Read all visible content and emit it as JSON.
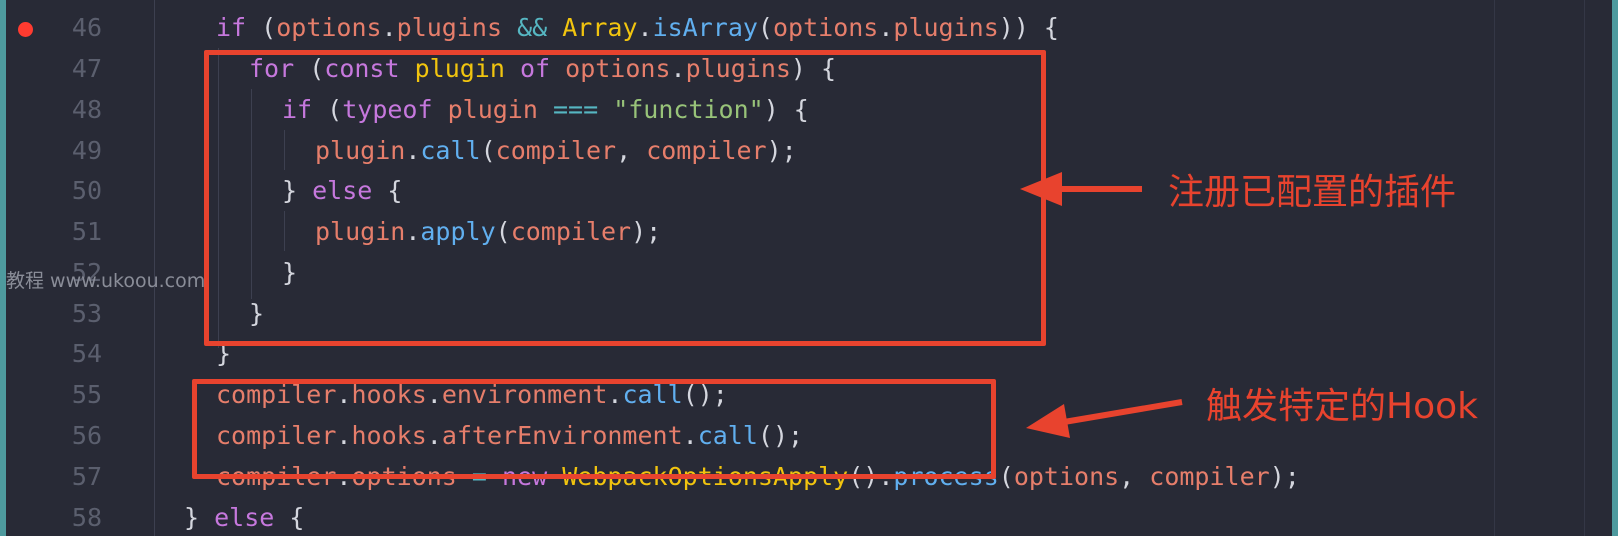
{
  "line_numbers": [
    "46",
    "47",
    "48",
    "49",
    "50",
    "51",
    "52",
    "53",
    "54",
    "55",
    "56",
    "57",
    "58"
  ],
  "code": {
    "l46": {
      "a": "if",
      "b": " (",
      "c": "options",
      ".": ".",
      "d": "plugins",
      "e": " ",
      "f": "&&",
      "g": " ",
      "h": "Array",
      "i": ".",
      "j": "isArray",
      "k": "(",
      "l": "options",
      "m": ".",
      "n": "plugins",
      "o": ")) {"
    },
    "l47": {
      "a": "for",
      "b": " (",
      "c": "const",
      "d": " ",
      "e": "plugin",
      "f": " ",
      "g": "of",
      "h": " ",
      "i": "options",
      "j": ".",
      "k": "plugins",
      "l": ") {"
    },
    "l48": {
      "a": "if",
      "b": " (",
      "c": "typeof",
      "d": " ",
      "e": "plugin",
      "f": " ",
      "g": "===",
      "h": " ",
      "i": "\"function\"",
      "j": ") {"
    },
    "l49": {
      "a": "plugin",
      "b": ".",
      "c": "call",
      "d": "(",
      "e": "compiler",
      "f": ", ",
      "g": "compiler",
      "h": ");"
    },
    "l50": {
      "a": "} ",
      "b": "else",
      "c": " {"
    },
    "l51": {
      "a": "plugin",
      "b": ".",
      "c": "apply",
      "d": "(",
      "e": "compiler",
      "f": ");"
    },
    "l52": {
      "a": "}"
    },
    "l53": {
      "a": "}"
    },
    "l54": {
      "a": "}"
    },
    "l55": {
      "a": "compiler",
      "b": ".",
      "c": "hooks",
      "d": ".",
      "e": "environment",
      "f": ".",
      "g": "call",
      "h": "();"
    },
    "l56": {
      "a": "compiler",
      "b": ".",
      "c": "hooks",
      "d": ".",
      "e": "afterEnvironment",
      "f": ".",
      "g": "call",
      "h": "();"
    },
    "l57": {
      "a": "compiler",
      "b": ".",
      "c": "options",
      "d": " ",
      "e": "=",
      "f": " ",
      "g": "new",
      "h": " ",
      "i": "WebpackOptionsApply",
      "j": "().",
      "k": "process",
      "l": "(",
      "m": "options",
      "n": ", ",
      "o": "compiler",
      "p": ");"
    },
    "l58": {
      "a": "} ",
      "b": "else",
      "c": " {"
    }
  },
  "annotations": {
    "plugins_label": "注册已配置的插件",
    "hook_label": "触发特定的Hook"
  },
  "watermark": "教程 www.ukoou.com",
  "colors": {
    "background": "#282a36",
    "keyword": "#c678dd",
    "variable": "#e67e6b",
    "class": "#f1c40f",
    "function": "#61afef",
    "string": "#98c379",
    "operator": "#56b6c2",
    "annotation": "#e8432e",
    "breakpoint": "#ff3b30"
  },
  "icons": {
    "breakpoint": "breakpoint-dot-icon",
    "arrow": "arrow-left-icon"
  }
}
